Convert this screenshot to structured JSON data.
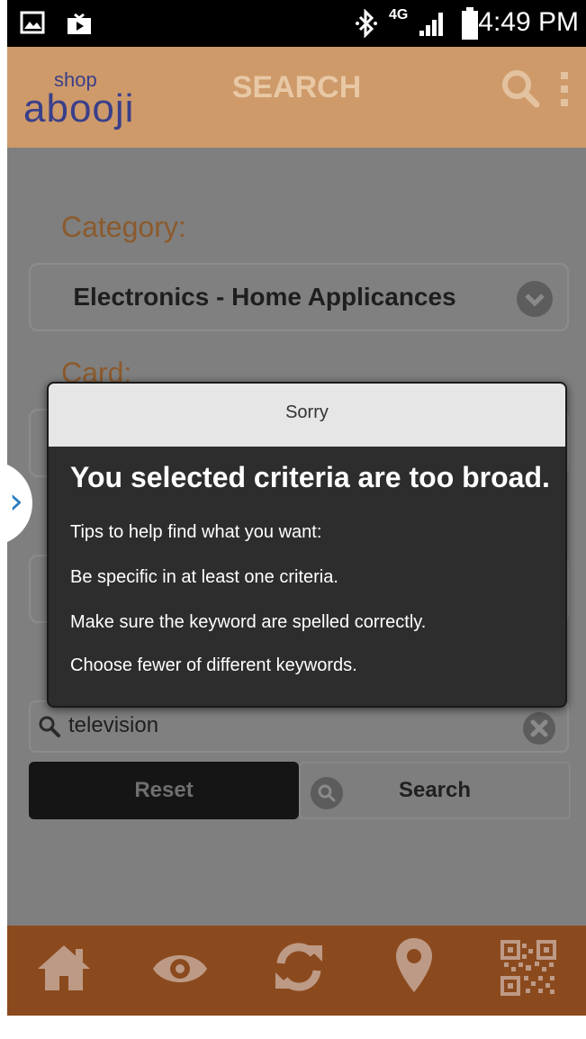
{
  "status_bar": {
    "time": "4:49 PM",
    "network": "4G",
    "icons": [
      "gallery-icon",
      "video-icon",
      "bluetooth-icon",
      "signal-icon",
      "battery-icon"
    ]
  },
  "header": {
    "logo_small": "shop",
    "logo_main": "abooji",
    "title": "SEARCH",
    "icons": [
      "search-icon",
      "overflow-menu-icon"
    ]
  },
  "form": {
    "category_label": "Category:",
    "category_value": "Electronics - Home Applicances",
    "card_label": "Card:",
    "search_value": "television",
    "reset_label": "Reset",
    "search_label": "Search"
  },
  "dialog": {
    "header": "Sorry",
    "title": "You selected criteria are too broad.",
    "tips": [
      "Tips to help find what you want:",
      "Be specific in at least one criteria.",
      "Make sure the keyword are spelled correctly.",
      "Choose fewer of different keywords."
    ]
  },
  "bottom_nav": {
    "icons": [
      "home-icon",
      "eye-icon",
      "refresh-icon",
      "location-pin-icon",
      "qr-code-icon"
    ]
  },
  "colors": {
    "header_bg": "#ce9a6a",
    "bottom_bg": "#8b4a1e",
    "label_brown": "#8c5a2c",
    "dialog_bg": "#2d2d2d"
  }
}
